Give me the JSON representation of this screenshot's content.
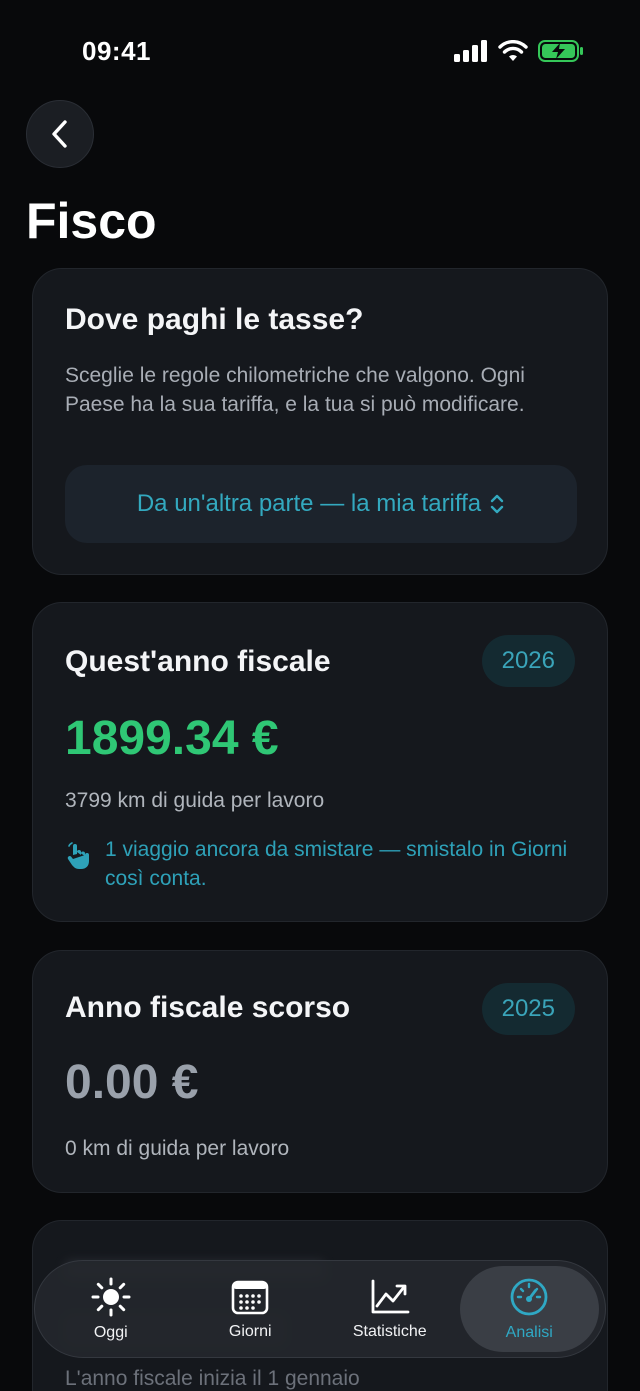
{
  "status": {
    "time": "09:41"
  },
  "header": {
    "title": "Fisco"
  },
  "tax_card": {
    "title": "Dove paghi le tasse?",
    "description": "Sceglie le regole chilometriche che valgono. Ogni Paese ha la sua tariffa, e la tua si può modificare.",
    "selector_value": "Da un'altra parte — la mia tariffa"
  },
  "current_year": {
    "title": "Quest'anno fiscale",
    "year": "2026",
    "amount": "1899.34 €",
    "km": "3799 km di guida per lavoro",
    "hint": "1 viaggio ancora da smistare — smistalo in Giorni così conta."
  },
  "previous_year": {
    "title": "Anno fiscale scorso",
    "year": "2025",
    "amount": "0.00 €",
    "km": "0 km di guida per lavoro"
  },
  "peek_card": {
    "footer": "L'anno fiscale inizia il 1 gennaio"
  },
  "colors": {
    "accent": "#2fa8c4",
    "positive": "#2fc775",
    "muted_amount": "#9aa1ab"
  },
  "tabs": [
    {
      "label": "Oggi",
      "icon": "sun-icon"
    },
    {
      "label": "Giorni",
      "icon": "calendar-icon"
    },
    {
      "label": "Statistiche",
      "icon": "chart-icon"
    },
    {
      "label": "Analisi",
      "icon": "gauge-icon",
      "active": true
    }
  ]
}
